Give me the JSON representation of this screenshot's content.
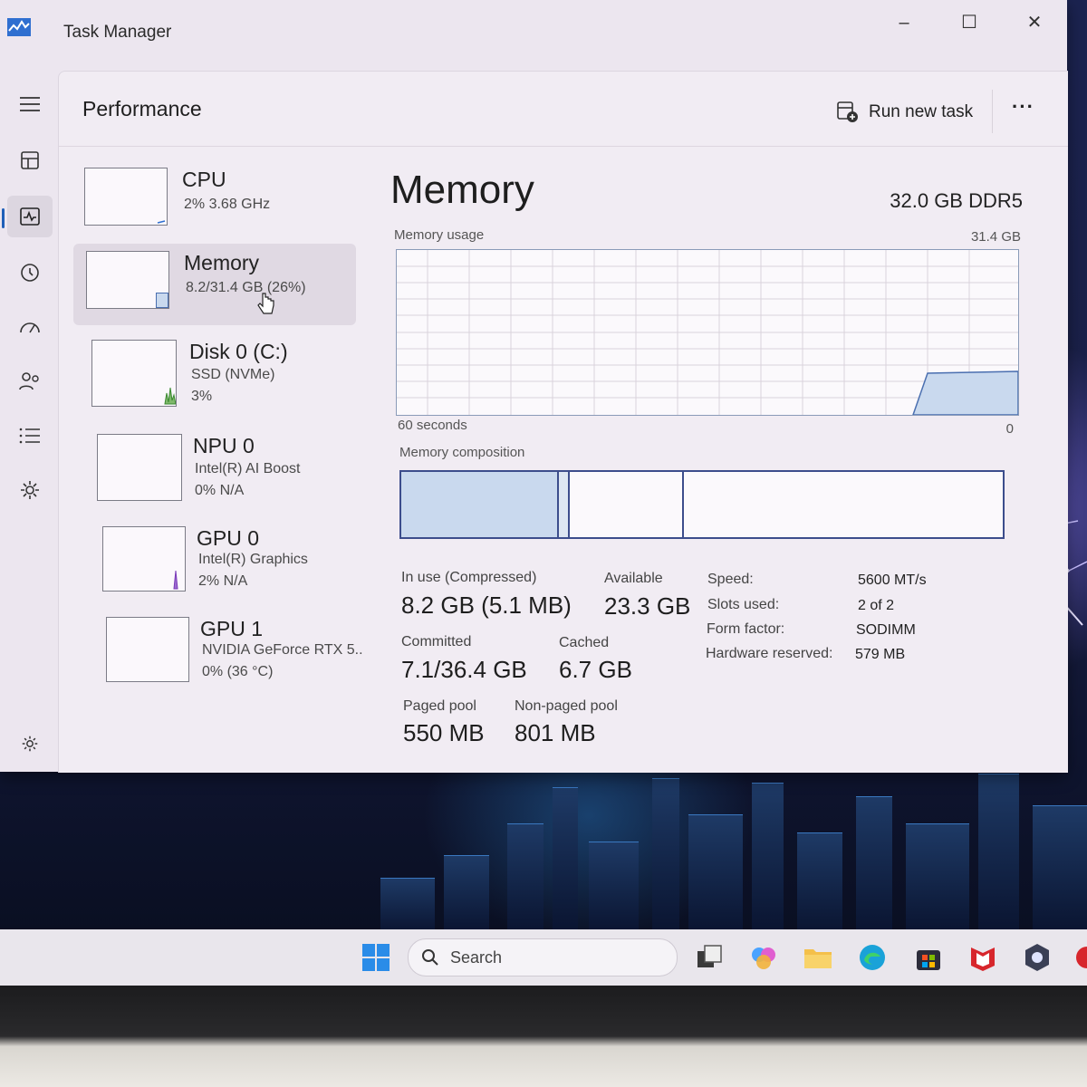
{
  "window": {
    "title": "Task Manager"
  },
  "header": {
    "page_title": "Performance",
    "run_new_task": "Run new task",
    "more": "···"
  },
  "devices": [
    {
      "name": "CPU",
      "line1": "2%  3.68 GHz",
      "line2": ""
    },
    {
      "name": "Memory",
      "line1": "8.2/31.4 GB (26%)",
      "line2": ""
    },
    {
      "name": "Disk 0 (C:)",
      "line1": "SSD (NVMe)",
      "line2": "3%"
    },
    {
      "name": "NPU 0",
      "line1": "Intel(R) AI Boost",
      "line2": "0%  N/A"
    },
    {
      "name": "GPU 0",
      "line1": "Intel(R) Graphics",
      "line2": "2%  N/A"
    },
    {
      "name": "GPU 1",
      "line1": "NVIDIA GeForce RTX 5..",
      "line2": "0%  (36 °C)"
    }
  ],
  "memory": {
    "title": "Memory",
    "spec": "32.0 GB DDR5",
    "usage_label": "Memory usage",
    "usage_max": "31.4 GB",
    "time_label": "60 seconds",
    "zero_label": "0",
    "composition_label": "Memory composition",
    "stats": {
      "in_use_label": "In use (Compressed)",
      "in_use": "8.2 GB (5.1 MB)",
      "available_label": "Available",
      "available": "23.3 GB",
      "committed_label": "Committed",
      "committed": "7.1/36.4 GB",
      "cached_label": "Cached",
      "cached": "6.7 GB",
      "paged_label": "Paged pool",
      "paged": "550 MB",
      "nonpaged_label": "Non-paged pool",
      "nonpaged": "801 MB"
    },
    "details": [
      {
        "k": "Speed:",
        "v": "5600 MT/s"
      },
      {
        "k": "Slots used:",
        "v": "2 of 2"
      },
      {
        "k": "Form factor:",
        "v": "SODIMM"
      },
      {
        "k": "Hardware reserved:",
        "v": "579 MB"
      }
    ]
  },
  "taskbar": {
    "search": "Search"
  },
  "colors": {
    "accent": "#1f5fb8",
    "memory_fill": "#c9d9ee",
    "memory_line": "#3c4d8c"
  }
}
